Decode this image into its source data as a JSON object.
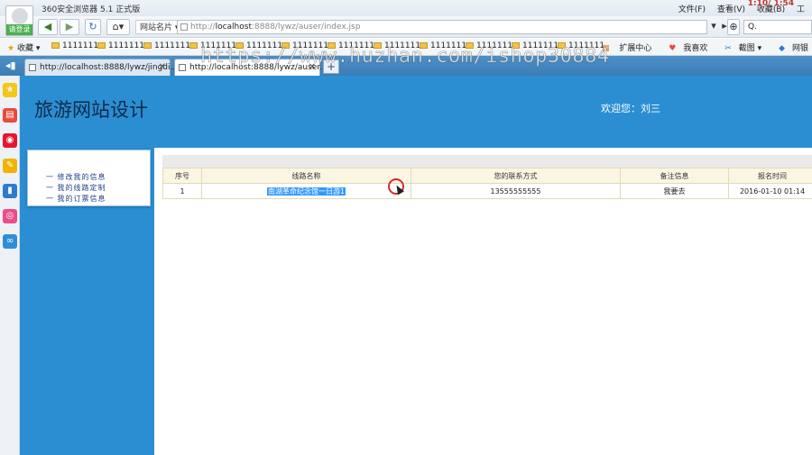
{
  "browser": {
    "app_title": "360安全浏览器 5.1 正式版",
    "clock": "1:10/ 1:54",
    "menus": [
      "文件(F)",
      "查看(V)",
      "收藏(B)",
      "工"
    ],
    "login_label": "请登录",
    "site_menu": "网站名片",
    "url_host": "localhost",
    "url_rest": ":8888/lywz/auser/index.jsp",
    "url_scheme": "http://",
    "search_placeholder": "Q."
  },
  "bookmarks": {
    "fav_label": "收藏",
    "items": [
      "1111111",
      "1111111",
      "1111111",
      "1111111",
      "1111111",
      "1111111",
      "1111111",
      "1111111",
      "1111111",
      "1111111",
      "1111111",
      "1111111"
    ],
    "tools": [
      "扩展中心",
      "我喜欢",
      "截图",
      "网银"
    ]
  },
  "tabs": [
    {
      "label": "http://localhost:8888/lywz/jingdi...",
      "active": false
    },
    {
      "label": "http://localhost:8888/lywz/auser...",
      "active": true
    }
  ],
  "side_icons": [
    {
      "name": "star-icon",
      "color": "#f5c518",
      "glyph": "★"
    },
    {
      "name": "news-icon",
      "color": "#e74c3c",
      "glyph": "▤"
    },
    {
      "name": "weibo-icon",
      "color": "#e6162d",
      "glyph": "◉"
    },
    {
      "name": "note-icon",
      "color": "#f0b400",
      "glyph": "✎"
    },
    {
      "name": "phone-icon",
      "color": "#2b7bd3",
      "glyph": "▮"
    },
    {
      "name": "target-icon",
      "color": "#e84e89",
      "glyph": "◎"
    },
    {
      "name": "cloud-icon",
      "color": "#2e8fd8",
      "glyph": "∞"
    }
  ],
  "site": {
    "title": "旅游网站设计",
    "welcome": "欢迎您：刘三",
    "menu": [
      "一 修改我的信息",
      "一 我的线路定制",
      "一 我的订票信息"
    ]
  },
  "table": {
    "headers": [
      "序号",
      "线路名称",
      "您的联系方式",
      "备注信息",
      "报名时间"
    ],
    "rows": [
      [
        "1",
        "南湖革命纪念馆一日游1",
        "13555555555",
        "我要去",
        "2016-01-10 01:14"
      ]
    ]
  },
  "watermark": "https://www.huzhan.com/ishop30884"
}
